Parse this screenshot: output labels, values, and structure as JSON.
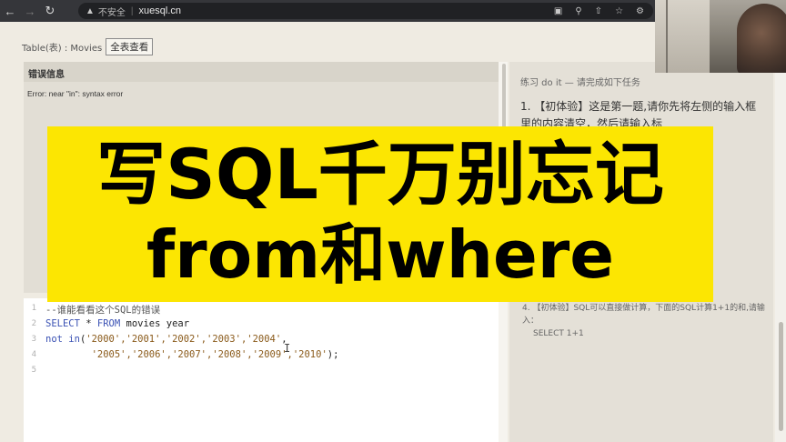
{
  "browser": {
    "insecure_label": "不安全",
    "url": "xuesql.cn",
    "icons": [
      "back-icon",
      "forward-icon",
      "reload-icon",
      "warning-icon",
      "translate-icon",
      "zoom-icon",
      "share-icon",
      "bookmark-star-icon",
      "extension-icon"
    ]
  },
  "table_bar": {
    "label": "Table(表) : Movies",
    "view_all": "全表查看"
  },
  "result": {
    "title": "错误信息",
    "message": "Error: near \"in\": syntax error"
  },
  "editor": {
    "lines": [
      {
        "n": "1",
        "comment": "--谁能看看这个SQL的错误"
      },
      {
        "n": "2",
        "kw1": "SELECT",
        "p1": " * ",
        "kw2": "FROM",
        "p2": " movies year"
      },
      {
        "n": "3",
        "kw1": "not in",
        "p1": "(",
        "str": "'2000','2001','2002','2003','2004'",
        "p2": ","
      },
      {
        "n": "4",
        "indent": "        ",
        "str": "'2005','2006','2007','2008','2009','2010'",
        "p2": ");"
      },
      {
        "n": "5"
      }
    ]
  },
  "tasks": {
    "heading": "练习 do it — 请完成如下任务",
    "task1": "1. 【初体验】这是第一题,请你先将左侧的输入框里的内容清空，然后请输入",
    "task1_tail": "标",
    "task4_q": "4. 【初体验】SQL可以直接做计算，下面的SQL计算1+1的和,请输入：",
    "task4_sql": "SELECT 1+1"
  },
  "banner": {
    "line1": "写SQL千万别忘记",
    "line2": "from和where"
  },
  "colors": {
    "banner_bg": "#fce602",
    "keyword": "#3b52b4",
    "string": "#8a5a1a"
  }
}
